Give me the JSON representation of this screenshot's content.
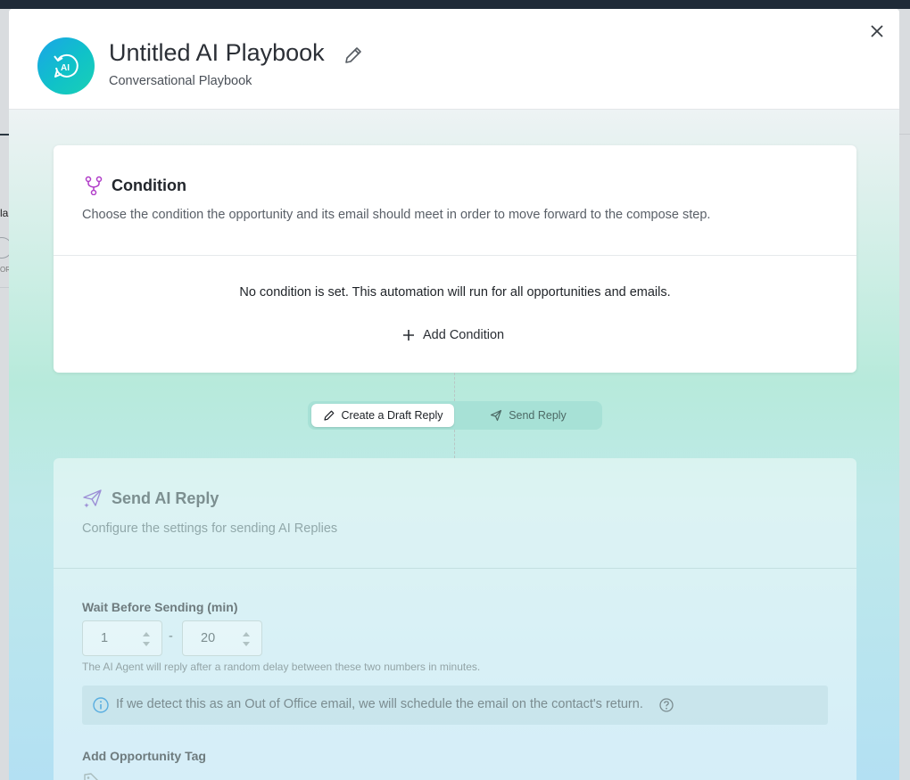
{
  "header": {
    "title": "Untitled AI Playbook",
    "subtitle": "Conversational Playbook",
    "logo_text": "AI",
    "icons": {
      "logo": "ai-refresh-icon",
      "edit": "pencil-icon",
      "close": "close-icon"
    }
  },
  "background": {
    "edge_text": "la",
    "edge_small": "OR"
  },
  "condition": {
    "title": "Condition",
    "description": "Choose the condition the opportunity and its email should meet in order to move forward to the compose step.",
    "empty_text": "No condition is set. This automation will run for all opportunities and emails.",
    "add_label": "Add Condition",
    "icons": {
      "header": "branch-icon",
      "add": "plus-icon"
    }
  },
  "mode_toggle": {
    "options": [
      {
        "label": "Create a Draft Reply",
        "icon": "pencil-icon",
        "selected": true
      },
      {
        "label": "Send Reply",
        "icon": "paper-plane-icon",
        "selected": false
      }
    ]
  },
  "send_reply": {
    "title": "Send AI Reply",
    "description": "Configure the settings for sending AI Replies",
    "wait_label": "Wait Before Sending (min)",
    "wait_min": "1",
    "wait_max": "20",
    "separator": "-",
    "wait_hint": "The AI Agent will reply after a random delay between these two numbers in minutes.",
    "ooo_text": "If we detect this as an Out of Office email, we will schedule the email on the contact's return.",
    "tag_label": "Add Opportunity Tag",
    "icons": {
      "header": "paper-plane-sparkle-icon",
      "info": "info-icon",
      "help": "question-icon",
      "tag": "tag-icon"
    }
  },
  "colors": {
    "accent_teal": "#10c2c8",
    "condition_icon": "#b03cc8",
    "toggle_bg": "#a7e1d6"
  }
}
